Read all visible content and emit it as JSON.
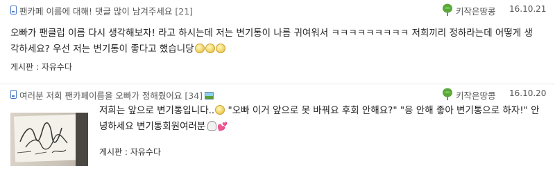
{
  "posts": [
    {
      "title": "팬카페 이름에 대해! 댓글 많이 남겨주세요",
      "comment_count": "[21]",
      "author": "키작은땅콩",
      "date": "16.10.21",
      "body": "오빠가 팬클럽 이름 다시 생각해보자! 라고 하시는데 저는 변기통이 나름 귀여워서 ㅋㅋㅋㅋㅋㅋㅋㅋㅋ 저희끼리 정하라는데 어떻게 생각하세요? 우선 저는 변기통이 좋다고 했습니당",
      "body_emoticons": [
        "smiley-icon",
        "smiley-icon",
        "smiley-icon"
      ],
      "board": "게시판 : 자유수다",
      "has_image_badge": false
    },
    {
      "title": "여러분 저희 팬카페이름을 오빠가 정해줬어요",
      "comment_count": "[34]",
      "author": "키작은땅콩",
      "date": "16.10.20",
      "body_part1": "저희는 앞으로 변기통입니다..",
      "body_part2": " \"오빠 이거 앞으로 못 바꿔요 후회 안해요?\" \"응 안해 좋아 변기통으로 하자!\" 안녕하세요 변기통회원여러분",
      "body_emoticons": [
        "smiley-icon",
        "ghost-icon",
        "hearts-icon"
      ],
      "board": "게시판 : 자유수다",
      "has_image_badge": true,
      "thumbnail": "handwritten-note-photo"
    }
  ],
  "colors": {
    "accent_icon": "#4a79c4",
    "tree_green": "#5aa73a",
    "text": "#222222",
    "meta": "#555555",
    "divider": "#e6e6e6"
  }
}
